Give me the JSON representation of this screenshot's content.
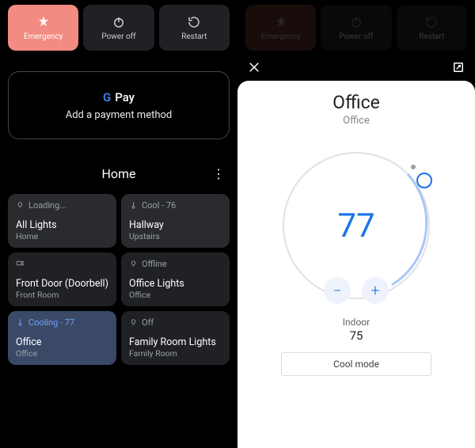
{
  "power": {
    "emergency": "Emergency",
    "poweroff": "Power off",
    "restart": "Restart"
  },
  "pay": {
    "brand_text": "Pay",
    "subtitle": "Add a payment method"
  },
  "home": {
    "title": "Home"
  },
  "tiles": [
    {
      "status": "Loading...",
      "name": "All Lights",
      "sub": "Home",
      "icon": "bulb"
    },
    {
      "status": "Cool - 76",
      "name": "Hallway",
      "sub": "Upstairs",
      "icon": "therm"
    },
    {
      "status": "",
      "name": "Front Door (Doorbell)",
      "sub": "Front Room",
      "icon": "cam"
    },
    {
      "status": "Offline",
      "name": "Office Lights",
      "sub": "Office",
      "icon": "bulb"
    },
    {
      "status": "Cooling - 77",
      "name": "Office",
      "sub": "Office",
      "icon": "therm"
    },
    {
      "status": "Off",
      "name": "Family Room Lights",
      "sub": "Family Room",
      "icon": "bulb"
    }
  ],
  "thermostat": {
    "title": "Office",
    "subtitle": "Office",
    "set_temp": "77",
    "indoor_label": "Indoor",
    "indoor_value": "75",
    "mode_label": "Cool mode",
    "minus": "−",
    "plus": "+"
  }
}
